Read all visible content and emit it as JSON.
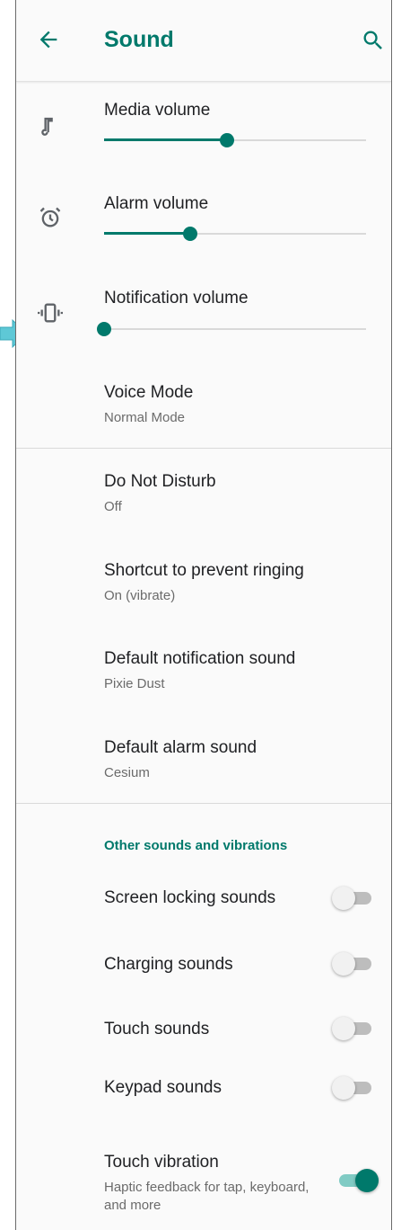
{
  "appbar": {
    "title": "Sound",
    "back_icon": "arrow-back-icon",
    "search_icon": "search-icon"
  },
  "volume": {
    "media": {
      "label": "Media volume",
      "icon": "music-note-icon",
      "level": 0.47
    },
    "alarm": {
      "label": "Alarm volume",
      "icon": "alarm-clock-icon",
      "level": 0.33
    },
    "notification": {
      "label": "Notification volume",
      "icon": "vibrate-icon",
      "level": 0.0
    },
    "voice_mode": {
      "label": "Voice Mode",
      "value": "Normal Mode"
    }
  },
  "settings": {
    "dnd": {
      "label": "Do Not Disturb",
      "value": "Off"
    },
    "shortcut": {
      "label": "Shortcut to prevent ringing",
      "value": "On (vibrate)"
    },
    "notif_sound": {
      "label": "Default notification sound",
      "value": "Pixie Dust"
    },
    "alarm_sound": {
      "label": "Default alarm sound",
      "value": "Cesium"
    }
  },
  "other": {
    "header": "Other sounds and vibrations",
    "screen_lock": {
      "label": "Screen locking sounds",
      "on": false
    },
    "charging": {
      "label": "Charging sounds",
      "on": false
    },
    "touch": {
      "label": "Touch sounds",
      "on": false
    },
    "keypad": {
      "label": "Keypad sounds",
      "on": false
    },
    "vibration": {
      "label": "Touch vibration",
      "value": "Haptic feedback for tap, keyboard, and more",
      "on": true
    }
  },
  "colors": {
    "accent": "#00796b",
    "accent_light": "#80cbc4",
    "pointer": "#5ec8d6"
  }
}
